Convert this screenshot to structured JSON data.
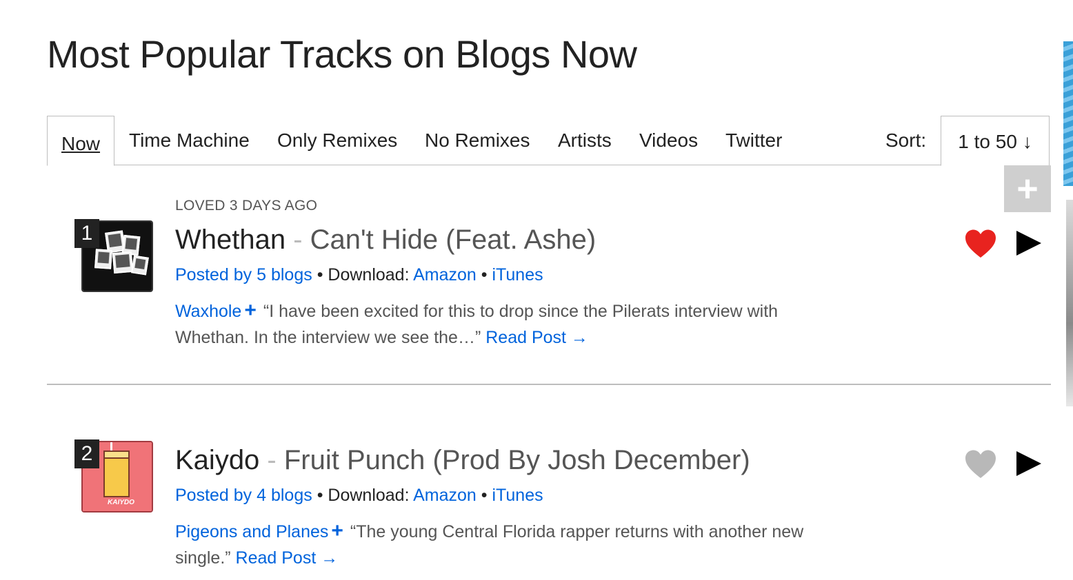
{
  "page": {
    "title": "Most Popular Tracks on Blogs Now"
  },
  "tabs": [
    {
      "label": "Now",
      "active": true
    },
    {
      "label": "Time Machine"
    },
    {
      "label": "Only Remixes"
    },
    {
      "label": "No Remixes"
    },
    {
      "label": "Artists"
    },
    {
      "label": "Videos"
    },
    {
      "label": "Twitter"
    }
  ],
  "sort": {
    "label": "Sort:",
    "value": "1 to 50 ↓"
  },
  "add_button": {
    "symbol": "+"
  },
  "tracks": [
    {
      "loved_label": "LOVED 3 DAYS AGO",
      "rank": "1",
      "artist": "Whethan",
      "separator": " - ",
      "song": "Can't Hide (Feat. Ashe)",
      "posted_by": "Posted by 5 blogs",
      "bullet": " • ",
      "download_label": "Download: ",
      "amazon": "Amazon",
      "itunes": "iTunes",
      "blog_name": "Waxhole",
      "blog_plus": "+",
      "quote": "“I have been excited for this to drop since the Pilerats interview with Whethan. In the interview we see the…”",
      "read_post": "Read Post →",
      "loved": true,
      "heart_color": "#e8231f"
    },
    {
      "loved_label": "",
      "rank": "2",
      "artist": "Kaiydo",
      "separator": " - ",
      "song": "Fruit Punch (Prod By Josh December)",
      "posted_by": "Posted by 4 blogs",
      "bullet": " • ",
      "download_label": "Download: ",
      "amazon": "Amazon",
      "itunes": "iTunes",
      "blog_name": "Pigeons and Planes",
      "blog_plus": "+",
      "quote": "“The young Central Florida rapper returns with another new single.”",
      "read_post": "Read Post →",
      "loved": false,
      "heart_color": "#b8b8b8"
    }
  ],
  "colors": {
    "link": "#0063dc",
    "heart_loved": "#e8231f",
    "heart_unloved": "#b8b8b8"
  }
}
